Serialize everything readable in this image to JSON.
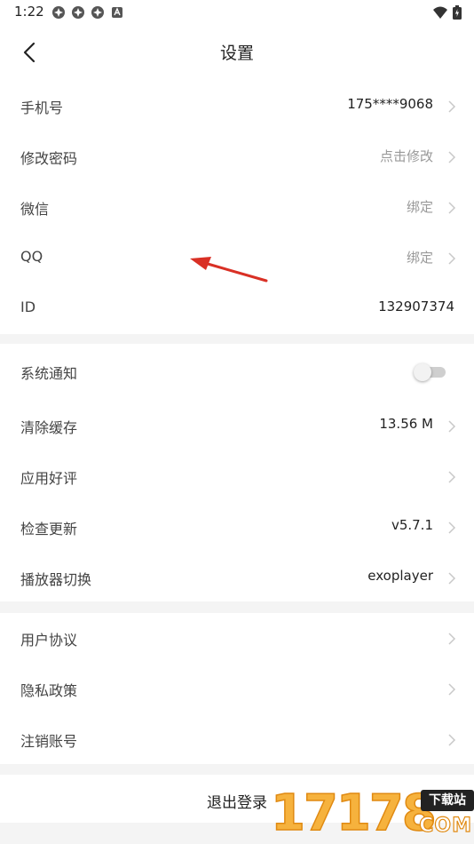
{
  "status_bar": {
    "time": "1:22"
  },
  "header": {
    "title": "设置"
  },
  "account_rows": [
    {
      "label": "手机号",
      "value": "175****9068"
    },
    {
      "label": "修改密码",
      "value": "点击修改"
    },
    {
      "label": "微信",
      "value": "绑定"
    },
    {
      "label": "QQ",
      "value": "绑定"
    },
    {
      "label": "ID",
      "value": "132907374"
    }
  ],
  "settings_rows": [
    {
      "label": "系统通知",
      "toggle_on": false
    },
    {
      "label": "清除缓存",
      "value": "13.56 M"
    },
    {
      "label": "应用好评",
      "value": ""
    },
    {
      "label": "检查更新",
      "value": "v5.7.1"
    },
    {
      "label": "播放器切换",
      "value": "exoplayer"
    }
  ],
  "legal_rows": [
    {
      "label": "用户协议"
    },
    {
      "label": "隐私政策"
    },
    {
      "label": "注销账号"
    }
  ],
  "logout": {
    "label": "退出登录"
  },
  "watermark": {
    "number": "17178",
    "badge": "下载站",
    "domain": "COM"
  },
  "colors": {
    "accent_arrow": "#d93025",
    "watermark_orange": "#f6b23d",
    "separator": "#f4f4f4"
  }
}
